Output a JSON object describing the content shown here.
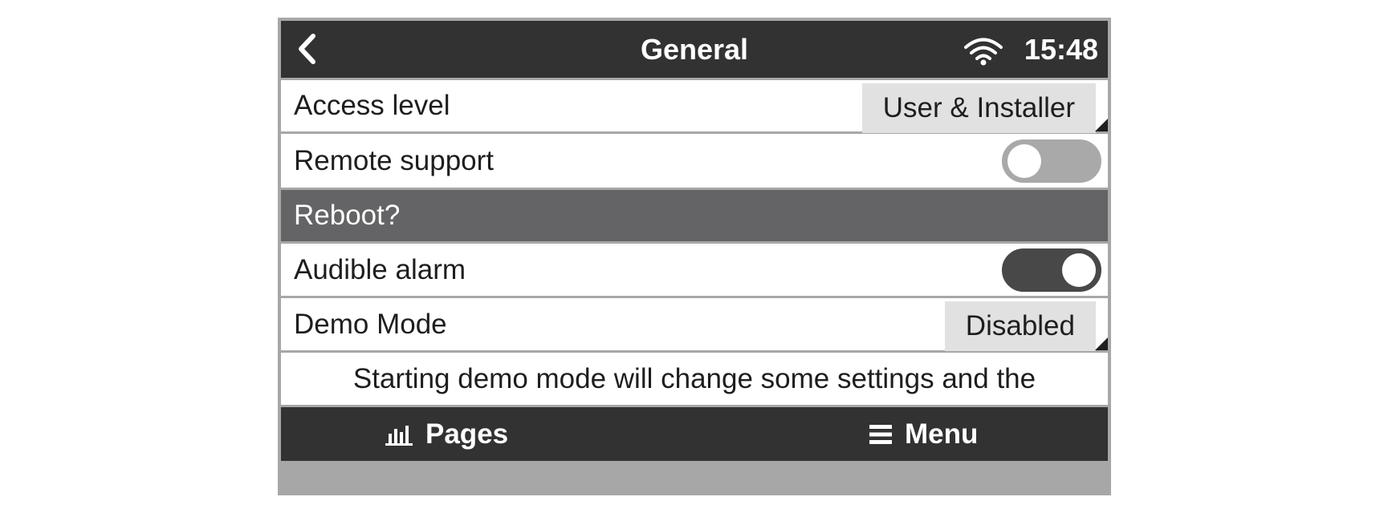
{
  "header": {
    "title": "General",
    "time": "15:48",
    "back_icon": "chevron-left-icon",
    "status_icon": "wifi-icon"
  },
  "settings": {
    "access_level": {
      "label": "Access level",
      "value": "User & Installer"
    },
    "remote_support": {
      "label": "Remote support",
      "enabled": false
    },
    "reboot": {
      "label": "Reboot?"
    },
    "audible_alarm": {
      "label": "Audible alarm",
      "enabled": true
    },
    "demo_mode": {
      "label": "Demo Mode",
      "value": "Disabled"
    },
    "demo_notice": "Starting demo mode will change some settings and the"
  },
  "footer": {
    "pages_label": "Pages",
    "pages_icon": "bar-chart-icon",
    "menu_label": "Menu",
    "menu_icon": "hamburger-menu-icon"
  },
  "colors": {
    "bar_background": "#333232",
    "section_background": "#646466",
    "row_background": "#ffffff",
    "selector_background": "#e1e1e1",
    "toggle_off": "#a9a9a9",
    "toggle_on": "#484848",
    "divider": "#a7a7a7"
  }
}
